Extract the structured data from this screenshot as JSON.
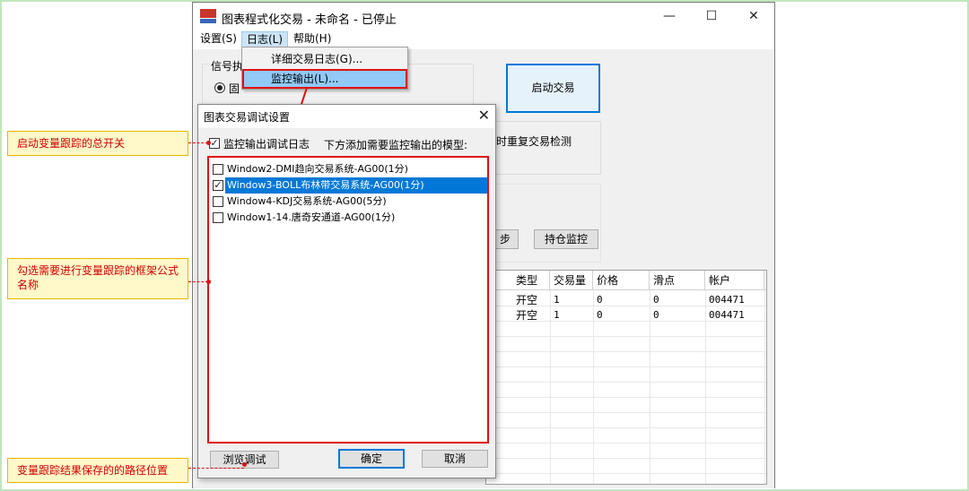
{
  "window": {
    "title": "图表程式化交易 - 未命名 - 已停止",
    "controls": {
      "minimize": "—",
      "maximize": "☐",
      "close": "✕"
    }
  },
  "menu": {
    "items": [
      {
        "label": "设置(S)"
      },
      {
        "label": "日志(L)"
      },
      {
        "label": "帮助(H)"
      }
    ],
    "dropdown": [
      {
        "label": "详细交易日志(G)..."
      },
      {
        "label": "监控输出(L)..."
      }
    ]
  },
  "main": {
    "group_label": "信号执",
    "radio_label": "固",
    "start_button": "启动交易",
    "repeat_check_label": "时重复交易检测",
    "sync_button": "步",
    "position_button": "持仓监控"
  },
  "grid": {
    "headers": [
      "类型",
      "交易量",
      "价格",
      "滑点",
      "帐户"
    ],
    "rows": [
      [
        "开空",
        "1",
        "0",
        "0",
        "004471"
      ],
      [
        "开空",
        "1",
        "0",
        "0",
        "004471"
      ]
    ]
  },
  "dialog": {
    "title": "图表交易调试设置",
    "close": "✕",
    "enable_label": "监控输出调试日志",
    "hint": "下方添加需要监控输出的模型:",
    "models": [
      {
        "label": "Window2-DMI趋向交易系统-AG00(1分)",
        "checked": false
      },
      {
        "label": "Window3-BOLL布林带交易系统-AG00(1分)",
        "checked": true
      },
      {
        "label": "Window4-KDJ交易系统-AG00(5分)",
        "checked": false
      },
      {
        "label": "Window1-14.唐奇安通道-AG00(1分)",
        "checked": false
      }
    ],
    "browse_button": "浏览调试",
    "ok_button": "确定",
    "cancel_button": "取消"
  },
  "annotations": [
    {
      "text": "启动变量跟踪的总开关"
    },
    {
      "text": "勾选需要进行变量跟踪的框架公式名称"
    },
    {
      "text": "变量跟踪结果保存的的路径位置"
    }
  ],
  "colors": {
    "accent": "#0078d7",
    "highlight_red": "#e01010",
    "note_bg": "#fff8c8"
  }
}
